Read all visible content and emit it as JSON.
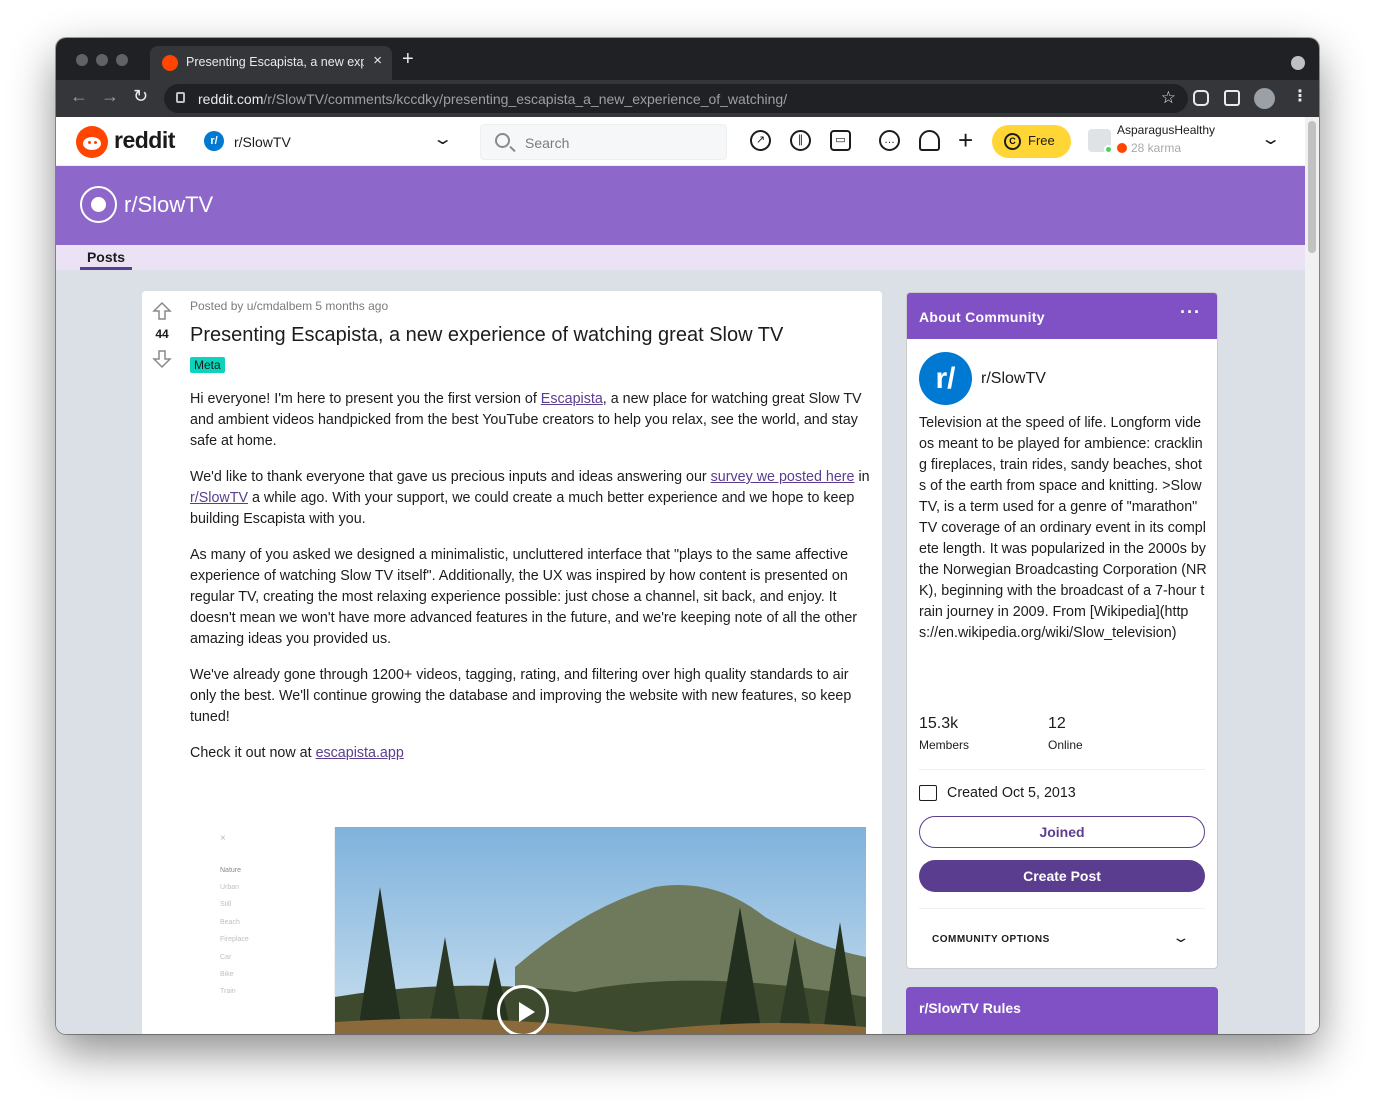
{
  "browser": {
    "tab_title": "Presenting Escapista, a new experience of watching great Slow TV",
    "tab_close": "×",
    "new_tab": "+",
    "url_host": "reddit.com",
    "url_path": "/r/SlowTV/comments/kccdky/presenting_escapista_a_new_experience_of_watching/"
  },
  "header": {
    "wordmark": "reddit",
    "community_icon": "r/",
    "community": "r/SlowTV",
    "search_placeholder": "Search",
    "free_label": "Free",
    "username": "AsparagusHealthy",
    "karma": "28 karma"
  },
  "banner": {
    "title": "r/SlowTV"
  },
  "subnav": {
    "posts_tab": "Posts"
  },
  "post": {
    "votes": "44",
    "meta": "Posted by u/cmdalbem 5 months ago",
    "title": "Presenting Escapista, a new experience of watching great Slow TV",
    "flair": "Meta",
    "p1_before": "Hi everyone! I'm here to present you the first version of ",
    "p1_link": "Escapista",
    "p1_after": ", a new place for watching great Slow TV and ambient videos handpicked from the best YouTube creators to help you relax, see the world, and stay safe at home.",
    "p2_before": "We'd like to thank everyone that gave us precious inputs and ideas answering our ",
    "p2_link1": "survey we posted here",
    "p2_mid": " in ",
    "p2_link2": "r/SlowTV",
    "p2_after": " a while ago. With your support, we could create a much better experience and we hope to keep building Escapista with you.",
    "p3": "As many of you asked we designed a minimalistic, uncluttered interface that \"plays to the same affective experience of watching Slow TV itself\". Additionally, the UX was inspired by how content is presented on regular TV, creating the most relaxing experience possible: just chose a channel, sit back, and enjoy. It doesn't mean we won't have more advanced features in the future, and we're keeping note of all the other amazing ideas you provided us.",
    "p4": "We've already gone through 1200+ videos, tagging, rating, and filtering over high quality standards to air only the best. We'll continue growing the database and improving the website with new features, so keep tuned!",
    "p5_before": "Check it out now at ",
    "p5_link": "escapista.app",
    "media": {
      "close": "×",
      "categories": [
        "Nature",
        "Urban",
        "Still",
        "Beach",
        "Fireplace",
        "Car",
        "Bike",
        "Train"
      ]
    }
  },
  "sidebar": {
    "about_title": "About Community",
    "menu": "···",
    "icon_text": "r/",
    "name": "r/SlowTV",
    "description": "Television at the speed of life. Longform videos meant to be played for ambience: crackling fireplaces, train rides, sandy beaches, shots of the earth from space and knitting. >Slow TV, is a term used for a genre of \"marathon\" TV coverage of an ordinary event in its complete length. It was popularized in the 2000s by the Norwegian Broadcasting Corporation (NRK), beginning with the broadcast of a 7-hour train journey in 2009. From [Wikipedia](https://en.wikipedia.org/wiki/Slow_television)",
    "members_count": "15.3k",
    "members_label": "Members",
    "online_count": "12",
    "online_label": "Online",
    "created": "Created Oct 5, 2013",
    "joined_label": "Joined",
    "create_post_label": "Create Post",
    "options_label": "COMMUNITY OPTIONS",
    "rules_title": "r/SlowTV Rules"
  },
  "colors": {
    "brand_orange": "#ff4500",
    "banner_purple": "#8d67c9",
    "accent_purple": "#5b3d8f",
    "flair_teal": "#0dd3bb",
    "premium_yellow": "#ffd635"
  }
}
